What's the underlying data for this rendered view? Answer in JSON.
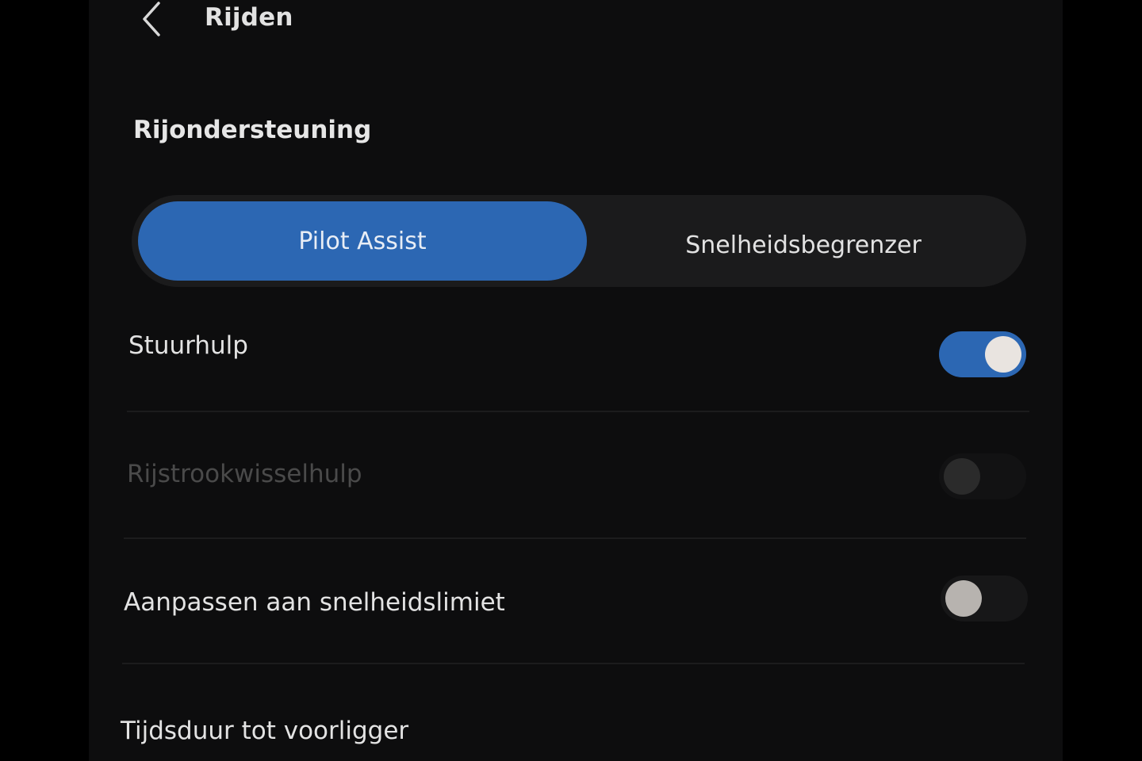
{
  "header": {
    "title": "Rijden",
    "back_icon": "chevron-left-icon"
  },
  "section": {
    "title": "Rijondersteuning"
  },
  "segmented": {
    "options": [
      {
        "label": "Pilot Assist",
        "selected": true
      },
      {
        "label": "Snelheidsbegrenzer",
        "selected": false
      }
    ]
  },
  "settings": [
    {
      "label": "Stuurhulp",
      "state": "on",
      "enabled": true
    },
    {
      "label": "Rijstrookwisselhulp",
      "state": "off",
      "enabled": false
    },
    {
      "label": "Aanpassen aan snelheidslimiet",
      "state": "off",
      "enabled": true
    },
    {
      "label": "Tijdsduur tot voorligger"
    }
  ],
  "colors": {
    "accent": "#2c67b3",
    "background": "#0d0d0e",
    "text": "#e3e3e3",
    "disabled_text": "#4a4a4a"
  }
}
